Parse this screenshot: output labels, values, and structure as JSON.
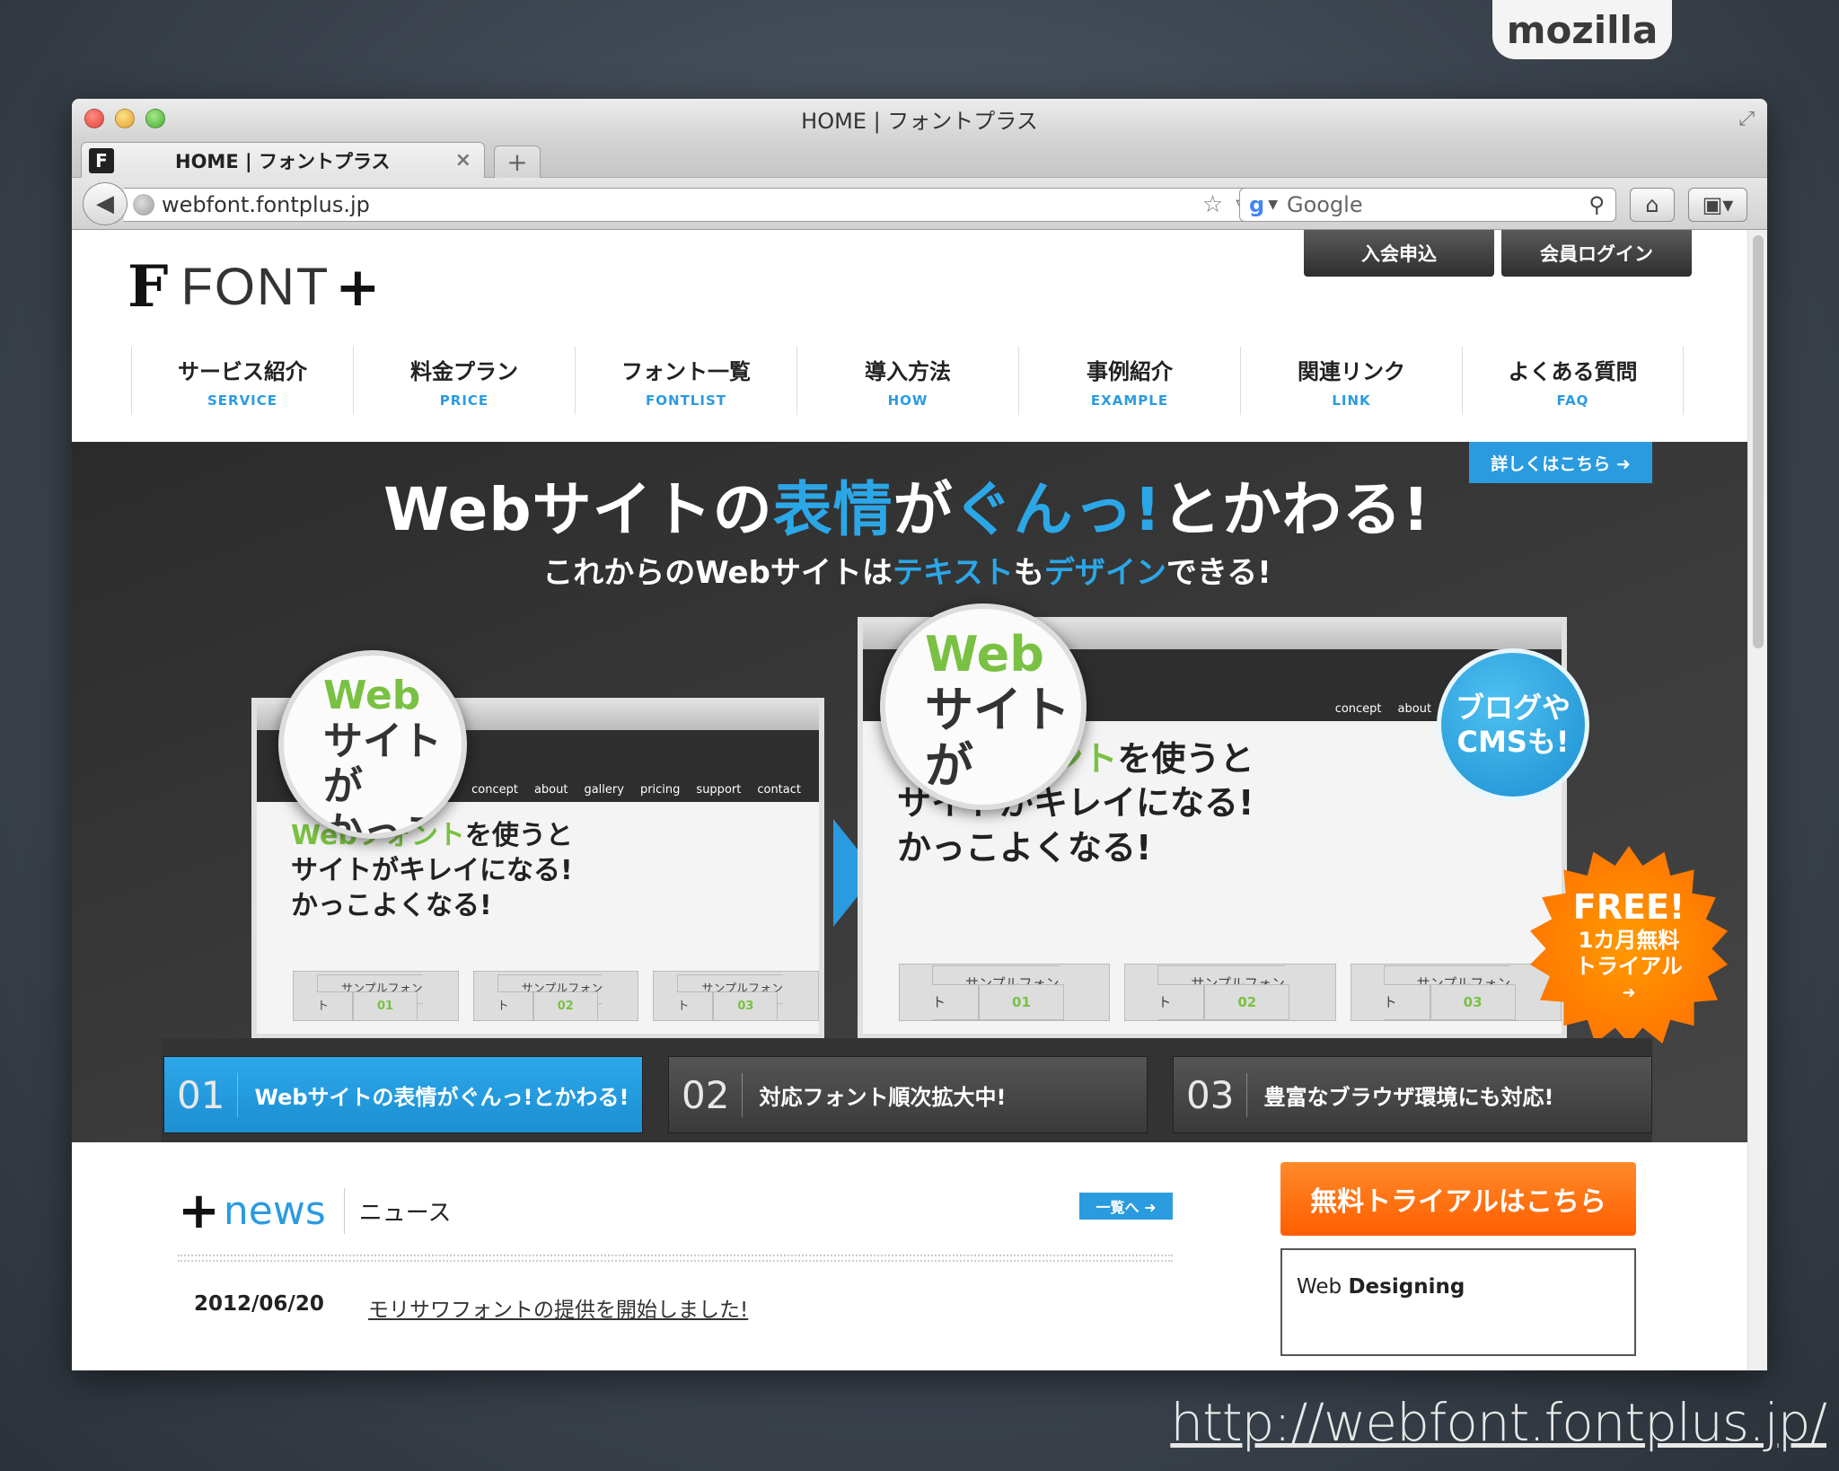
{
  "slide": {
    "brand": "mozilla",
    "footer_url": "http://webfont.fontplus.jp/"
  },
  "window": {
    "title": "HOME | フォントプラス",
    "tab": {
      "title": "HOME | フォントプラス",
      "close": "×"
    },
    "new_tab": "+",
    "url": "webfont.fontplus.jp",
    "search_placeholder": "Google"
  },
  "site": {
    "logo": {
      "mark": "F",
      "text": "FONT",
      "plus": "+"
    },
    "top_buttons": {
      "join": "入会申込",
      "login": "会員ログイン"
    },
    "nav": [
      {
        "jp": "サービス紹介",
        "en": "SERVICE"
      },
      {
        "jp": "料金プラン",
        "en": "PRICE"
      },
      {
        "jp": "フォント一覧",
        "en": "FONTLIST"
      },
      {
        "jp": "導入方法",
        "en": "HOW"
      },
      {
        "jp": "事例紹介",
        "en": "EXAMPLE"
      },
      {
        "jp": "関連リンク",
        "en": "LINK"
      },
      {
        "jp": "よくある質問",
        "en": "FAQ"
      }
    ],
    "hero": {
      "detail_button": "詳しくはこちら ➜",
      "headline": {
        "a": "Webサイトの",
        "b": "表情",
        "c": "が",
        "d": "ぐんっ!",
        "e": "とかわる!"
      },
      "subline": {
        "a": "これからのWebサイトは",
        "b": "テキスト",
        "c": "も",
        "d": "デザイン",
        "e": "できる!"
      },
      "mock_menu": [
        "concept",
        "about",
        "gallery",
        "pricing",
        "support",
        "contact"
      ],
      "mock_copy": {
        "green": "Webフォント",
        "l1": "を使うと",
        "l2": "サイトがキレイになる!",
        "l3": "かっこよくなる!"
      },
      "mock_buttons": [
        {
          "label": "サンプルフォント",
          "num": "01"
        },
        {
          "label": "サンプルフォント",
          "num": "02"
        },
        {
          "label": "サンプルフォント",
          "num": "03"
        }
      ],
      "lens": {
        "l1": "Web",
        "l2": "サイトが",
        "l3": "かっこ"
      },
      "badge_blog": {
        "l1": "ブログや",
        "l2": "CMSも!"
      },
      "badge_free": {
        "l1": "FREE!",
        "l2": "1カ月無料",
        "l3": "トライアル",
        "l4": "➜"
      },
      "tabs": [
        {
          "num": "01",
          "label": "Webサイトの表情がぐんっ!とかわる!"
        },
        {
          "num": "02",
          "label": "対応フォント順次拡大中!"
        },
        {
          "num": "03",
          "label": "豊富なブラウザ環境にも対応!"
        }
      ]
    },
    "news": {
      "plus": "+",
      "title_en": "news",
      "title_jp": "ニュース",
      "list_button": "一覧へ ➜",
      "items": [
        {
          "date": "2012/06/20",
          "text": "モリサワフォントの提供を開始しました!"
        }
      ]
    },
    "trial_button": "無料トライアルはこちら",
    "banner": {
      "a": "Web",
      "b": "Designing"
    }
  }
}
